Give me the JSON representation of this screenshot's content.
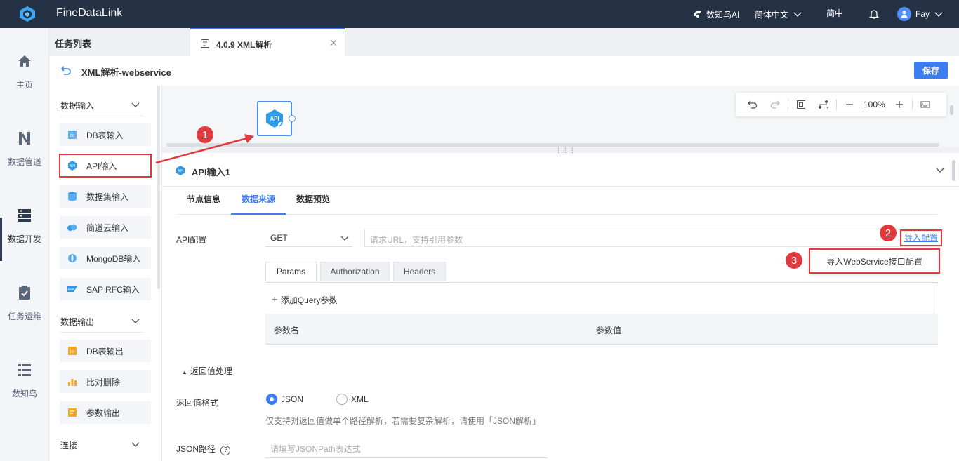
{
  "app": {
    "brand": "FineDataLink"
  },
  "topbar": {
    "ai_label": "数知鸟AI",
    "language": "简体中文",
    "simplified": "简中",
    "user": "Fay"
  },
  "leftnav": {
    "items": [
      {
        "label": "主页"
      },
      {
        "label": "数据管道"
      },
      {
        "label": "数据开发"
      },
      {
        "label": "任务运维"
      },
      {
        "label": "数知鸟"
      }
    ]
  },
  "tabs": {
    "list_label": "任务列表",
    "active_tab": "4.0.9 XML解析"
  },
  "header": {
    "title": "XML解析-webservice",
    "save_label": "保存"
  },
  "components": {
    "input_section": "数据输入",
    "inputs": [
      "DB表输入",
      "API输入",
      "数据集输入",
      "简道云输入",
      "MongoDB输入",
      "SAP RFC输入"
    ],
    "output_section": "数据输出",
    "outputs": [
      "DB表输出",
      "比对删除",
      "参数输出"
    ],
    "connect_section": "连接"
  },
  "canvas": {
    "node_label": "API",
    "zoom": "100%"
  },
  "annotations": {
    "b1": "1",
    "b2": "2",
    "b3": "3"
  },
  "config": {
    "node_title": "API输入1",
    "subtabs": [
      "节点信息",
      "数据来源",
      "数据预览"
    ],
    "api_label": "API配置",
    "method": "GET",
    "url_placeholder": "请求URL，支持引用参数",
    "import_link": "导入配置",
    "dropdown_item": "导入WebService接口配置",
    "param_tabs": [
      "Params",
      "Authorization",
      "Headers"
    ],
    "add_query": "添加Query参数",
    "col_name": "参数名",
    "col_value": "参数值",
    "return_toggle": "返回值处理",
    "return_format_label": "返回值格式",
    "format_json": "JSON",
    "format_xml": "XML",
    "hint": "仅支持对返回值做单个路径解析，若需要复杂解析，请使用「JSON解析」",
    "json_path_label": "JSON路径",
    "json_path_placeholder": "请填写JSONPath表达式"
  }
}
